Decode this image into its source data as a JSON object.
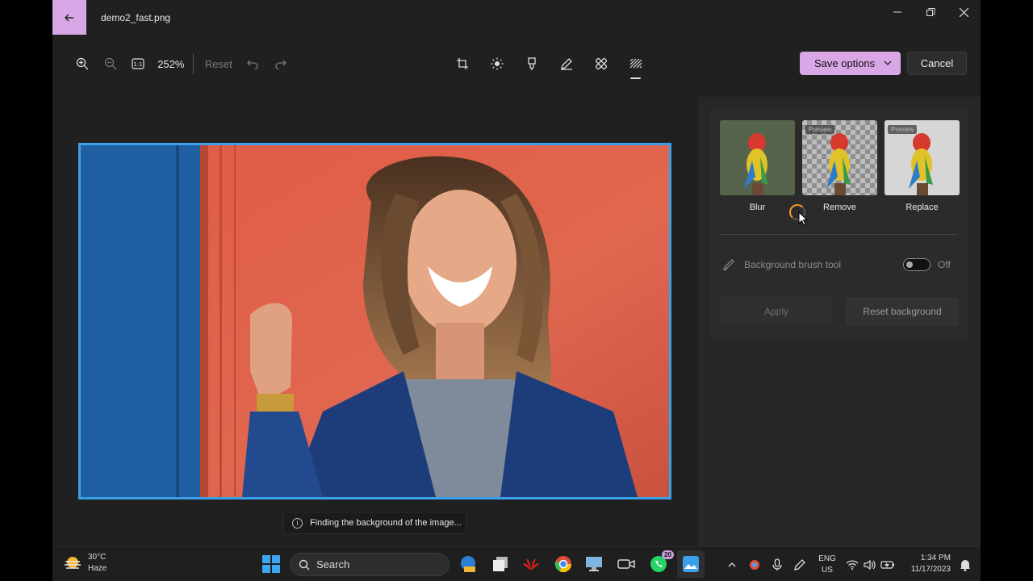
{
  "window": {
    "title": "demo2_fast.png"
  },
  "toolbar": {
    "zoom_level": "252%",
    "reset_label": "Reset",
    "save_label": "Save options",
    "cancel_label": "Cancel",
    "tools": [
      "crop-icon",
      "brightness-icon",
      "markup-icon",
      "pen-icon",
      "erase-icon",
      "background-icon"
    ]
  },
  "panel": {
    "options": [
      {
        "label": "Blur",
        "preview": ""
      },
      {
        "label": "Remove",
        "preview": "Preview"
      },
      {
        "label": "Replace",
        "preview": "Preview"
      }
    ],
    "brush_tool_label": "Background brush tool",
    "brush_tool_state": "Off",
    "apply_label": "Apply",
    "reset_background_label": "Reset background"
  },
  "status": {
    "toast": "Finding the background of the image..."
  },
  "taskbar": {
    "weather_temp": "30°C",
    "weather_desc": "Haze",
    "search_label": "Search",
    "whatsapp_badge": "20",
    "language_line1": "ENG",
    "language_line2": "US",
    "time": "1:34 PM",
    "date": "11/17/2023"
  },
  "colors": {
    "accent": "#d9a7e6",
    "selection_border": "#3aa0ea",
    "background": "#202020"
  }
}
